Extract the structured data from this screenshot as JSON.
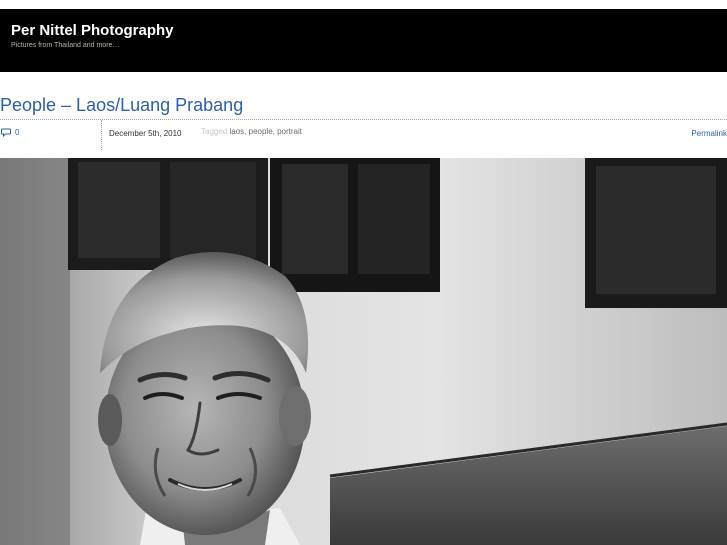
{
  "site": {
    "title": "Per Nittel Photography",
    "tagline": "Pictures from Thailand and more…"
  },
  "post": {
    "title": "People – Laos/Luang Prabang",
    "comment_count": "0",
    "date": "December 5th, 2010",
    "tagged_label": "Tagged",
    "tags": [
      "laos",
      "people",
      "portrait"
    ],
    "tag_separator": ", ",
    "permalink_label": "Permalink"
  },
  "photo": {
    "subject": "black-and-white portrait of a smiling elderly man in front of a wall with dark windows"
  },
  "colors": {
    "header_bg": "#000000",
    "link": "#2f5fa8",
    "tagline": "#bdb5a0"
  }
}
